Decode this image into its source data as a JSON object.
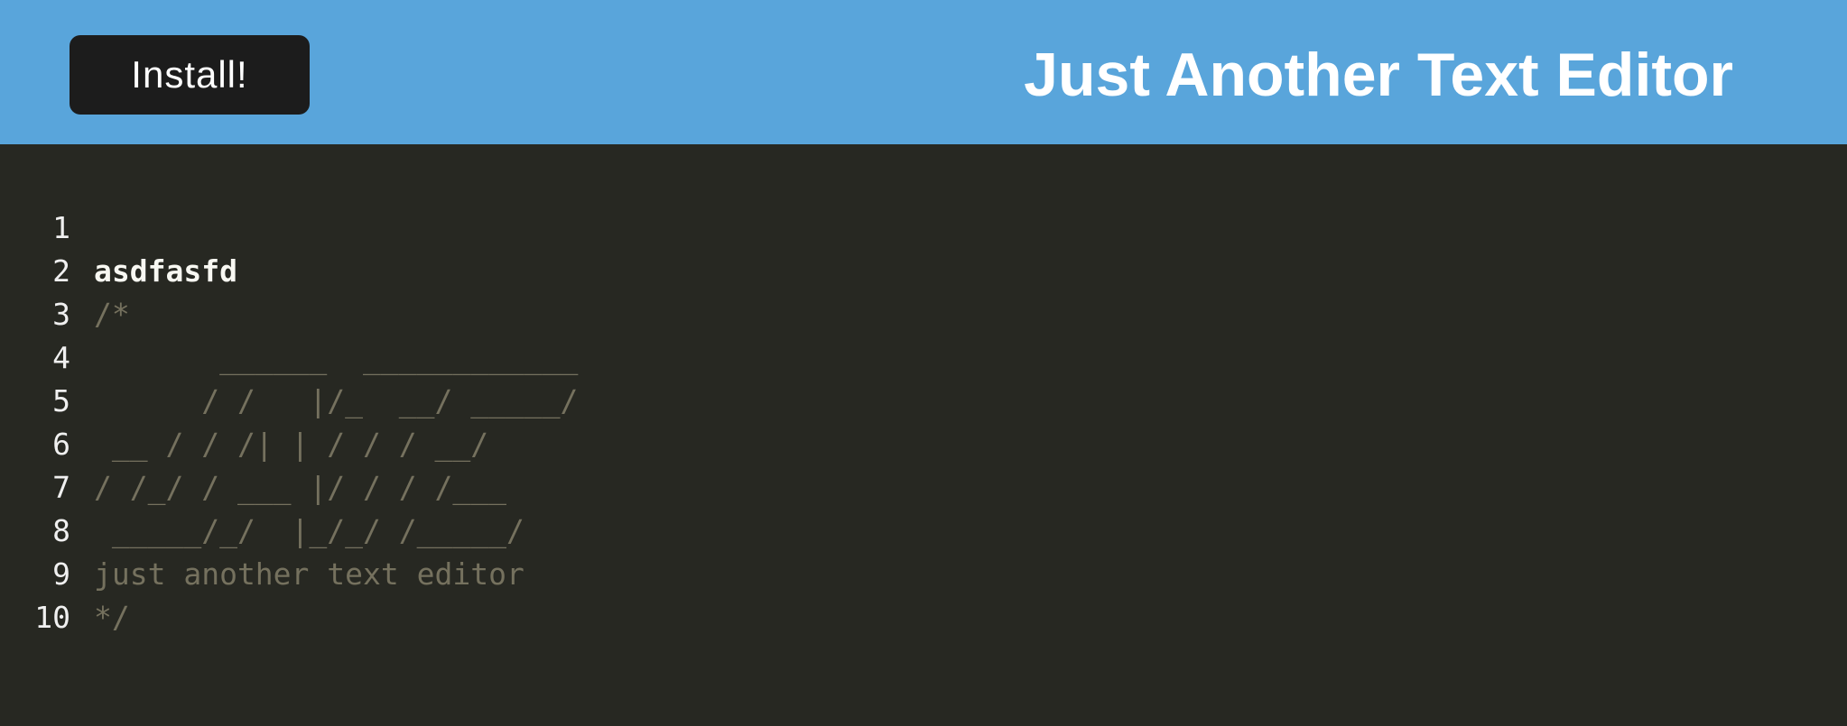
{
  "header": {
    "install_label": "Install!",
    "title": "Just Another Text Editor",
    "background_color": "#59a5db",
    "button_color": "#1c1c1c"
  },
  "editor": {
    "theme": "monokai",
    "background_color": "#272822",
    "comment_color": "#75715e",
    "lines": [
      {
        "number": "1",
        "text": "asdfasfd"
      },
      {
        "number": "2",
        "text": "/*"
      },
      {
        "number": "3",
        "text": "       ______  ____________"
      },
      {
        "number": "4",
        "text": "      / /   |/_  __/ _____/"
      },
      {
        "number": "5",
        "text": " __ / / /| | / / / __/"
      },
      {
        "number": "6",
        "text": "/ /_/ / ___ |/ / / /___"
      },
      {
        "number": "7",
        "text": " _____/_/  |_/_/ /_____/"
      },
      {
        "number": "8",
        "text": "just another text editor"
      },
      {
        "number": "9",
        "text": "*/"
      },
      {
        "number": "10",
        "text": ""
      }
    ]
  }
}
